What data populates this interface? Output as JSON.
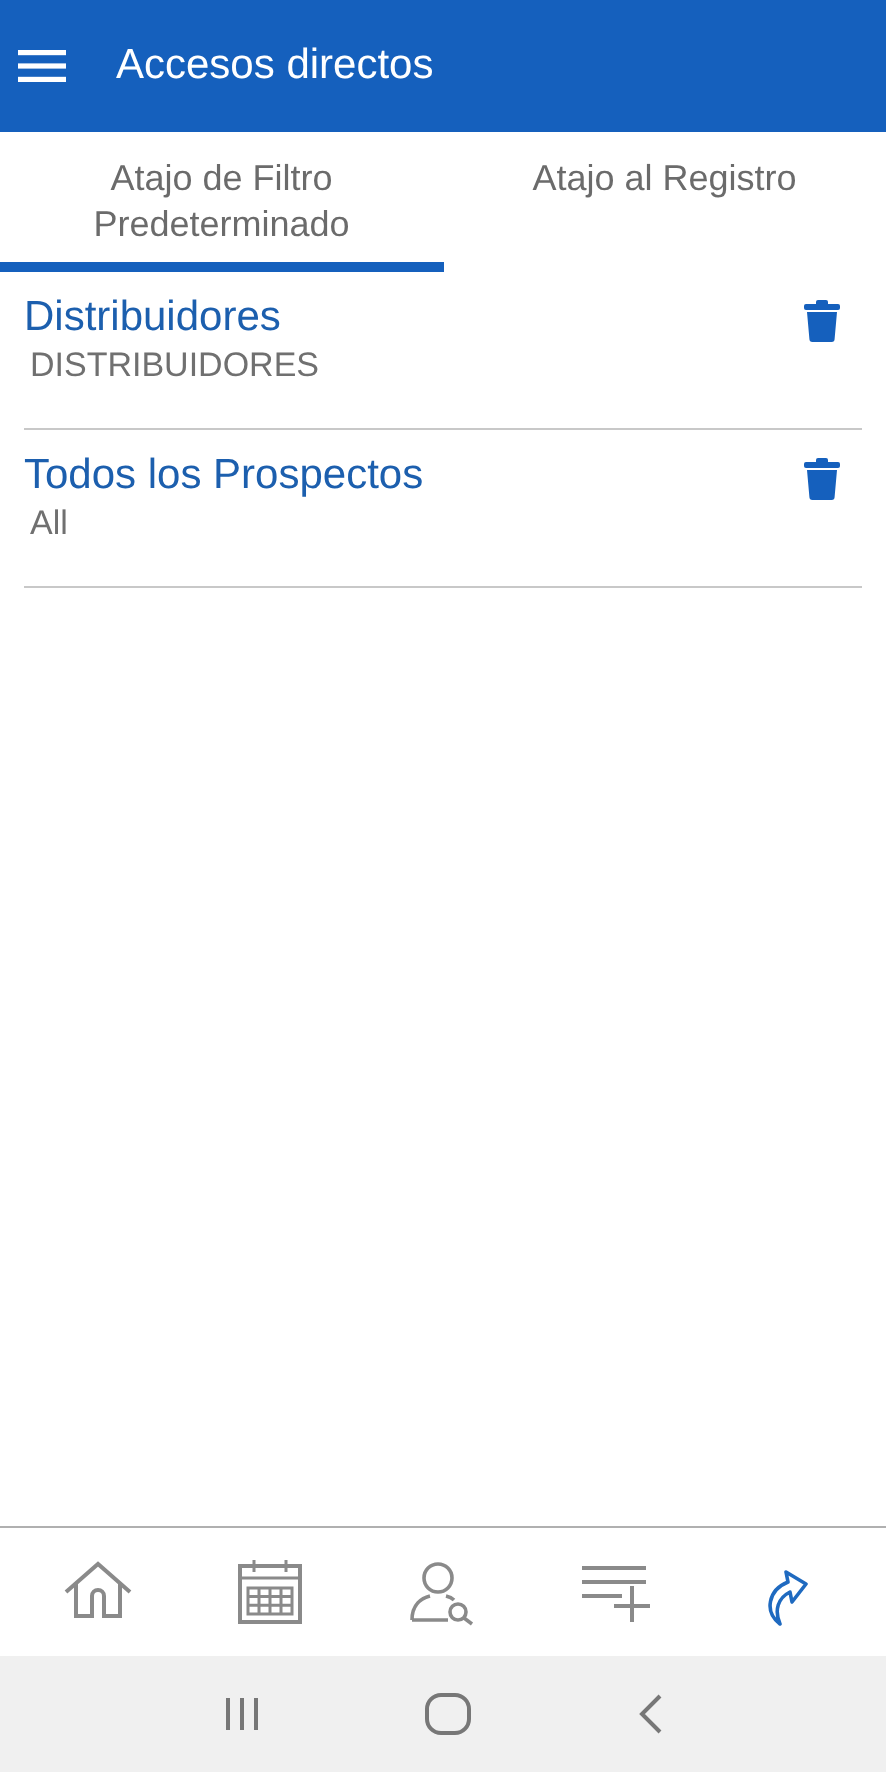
{
  "app_bar": {
    "title": "Accesos directos"
  },
  "tabs": [
    {
      "label": "Atajo de Filtro Predeterminado",
      "selected": true
    },
    {
      "label": "Atajo al Registro",
      "selected": false
    }
  ],
  "shortcuts": [
    {
      "title": "Distribuidores",
      "subtitle": "DISTRIBUIDORES"
    },
    {
      "title": "Todos los Prospectos",
      "subtitle": "All"
    }
  ],
  "bottom_nav": [
    {
      "kind": "home",
      "selected": false
    },
    {
      "kind": "calendar",
      "selected": false
    },
    {
      "kind": "contact-search",
      "selected": false
    },
    {
      "kind": "add-list",
      "selected": false
    },
    {
      "kind": "shortcut",
      "selected": true
    }
  ]
}
